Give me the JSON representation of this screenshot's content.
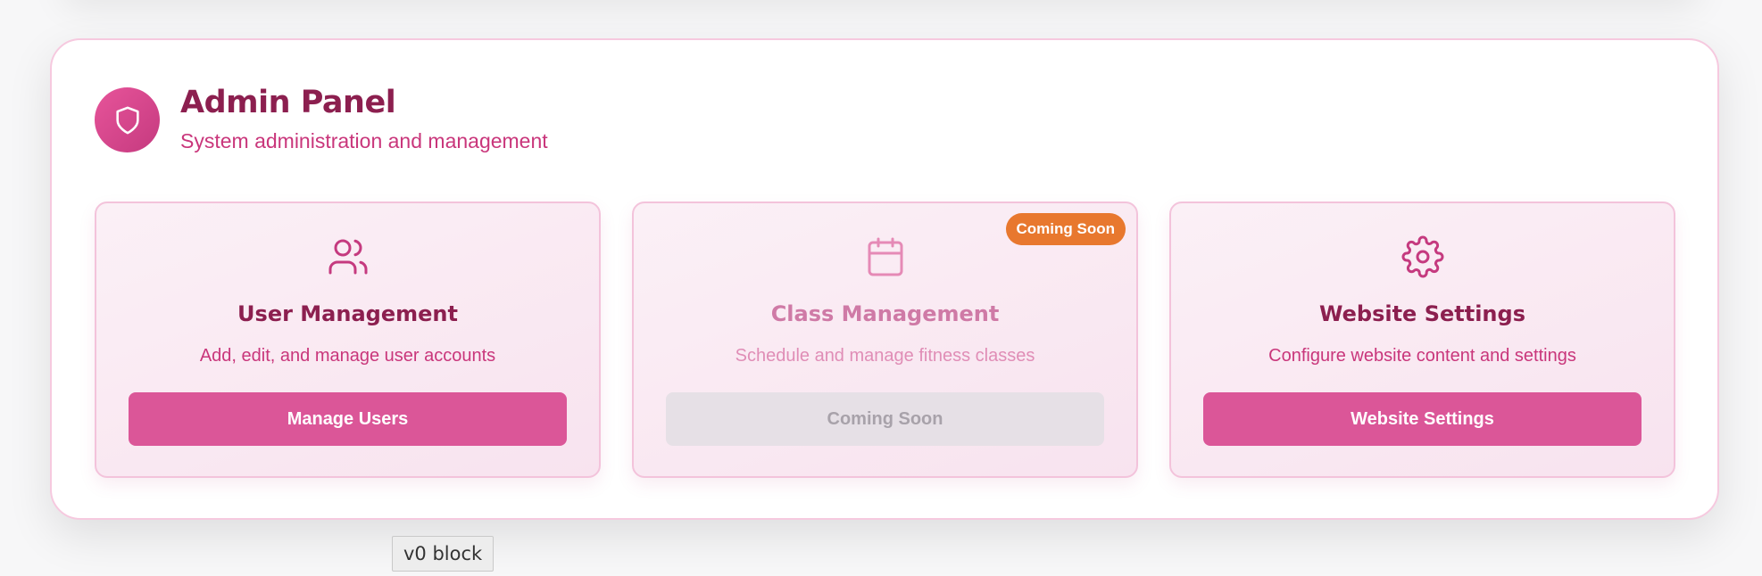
{
  "header": {
    "icon": "shield-icon",
    "title": "Admin Panel",
    "subtitle": "System administration and management"
  },
  "cards": [
    {
      "icon": "users-icon",
      "title": "User Management",
      "description": "Add, edit, and manage user accounts",
      "button": "Manage Users",
      "enabled": true
    },
    {
      "icon": "calendar-icon",
      "title": "Class Management",
      "description": "Schedule and manage fitness classes",
      "button": "Coming Soon",
      "badge": "Coming Soon",
      "enabled": false
    },
    {
      "icon": "gear-icon",
      "title": "Website Settings",
      "description": "Configure website content and settings",
      "button": "Website Settings",
      "enabled": true
    }
  ],
  "footer_tag": "v0 block",
  "colors": {
    "primary": "#db5698",
    "title": "#8c1f4f",
    "accent_text": "#c9367b",
    "badge": "#e8782e",
    "border": "#f3c3db"
  }
}
